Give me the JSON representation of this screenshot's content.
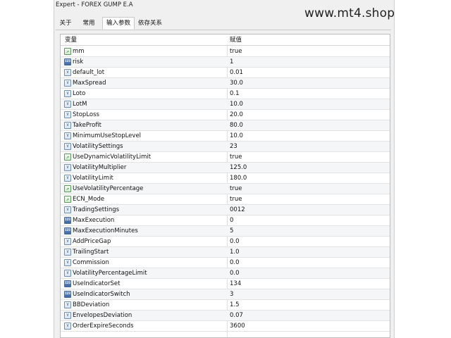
{
  "window": {
    "title": "Expert - FOREX GUMP E.A"
  },
  "watermark": "www.mt4.shop",
  "tabs": [
    {
      "label": "关于"
    },
    {
      "label": "常用"
    },
    {
      "label": "输入参数",
      "active": true
    },
    {
      "label": "依存关系"
    }
  ],
  "table": {
    "columns": {
      "variable": "变量",
      "value": "赋值"
    },
    "rows": [
      {
        "name": "mm",
        "value": "true",
        "icon": "bool-icon"
      },
      {
        "name": "risk",
        "value": "1",
        "icon": "int-icon"
      },
      {
        "name": "default_lot",
        "value": "0.01",
        "icon": "double-icon"
      },
      {
        "name": "MaxSpread",
        "value": "30.0",
        "icon": "double-icon"
      },
      {
        "name": "Loto",
        "value": "0.1",
        "icon": "double-icon"
      },
      {
        "name": "LotM",
        "value": "10.0",
        "icon": "double-icon"
      },
      {
        "name": "StopLoss",
        "value": "20.0",
        "icon": "double-icon"
      },
      {
        "name": "TakeProfit",
        "value": "80.0",
        "icon": "double-icon"
      },
      {
        "name": "MinimumUseStopLevel",
        "value": "10.0",
        "icon": "double-icon"
      },
      {
        "name": "VolatilitySettings",
        "value": "23",
        "icon": "double-icon"
      },
      {
        "name": "UseDynamicVolatilityLimit",
        "value": "true",
        "icon": "bool-icon"
      },
      {
        "name": "VolatilityMultiplier",
        "value": "125.0",
        "icon": "double-icon"
      },
      {
        "name": "VolatilityLimit",
        "value": "180.0",
        "icon": "double-icon"
      },
      {
        "name": "UseVolatilityPercentage",
        "value": "true",
        "icon": "bool-icon"
      },
      {
        "name": "ECN_Mode",
        "value": "true",
        "icon": "bool-icon"
      },
      {
        "name": "TradingSettings",
        "value": "0012",
        "icon": "double-icon"
      },
      {
        "name": "MaxExecution",
        "value": "0",
        "icon": "int-icon"
      },
      {
        "name": "MaxExecutionMinutes",
        "value": "5",
        "icon": "int-icon"
      },
      {
        "name": "AddPriceGap",
        "value": "0.0",
        "icon": "double-icon"
      },
      {
        "name": "TrailingStart",
        "value": "1.0",
        "icon": "double-icon"
      },
      {
        "name": "Commission",
        "value": "0.0",
        "icon": "double-icon"
      },
      {
        "name": "VolatilityPercentageLimit",
        "value": "0.0",
        "icon": "double-icon"
      },
      {
        "name": "UseIndicatorSet",
        "value": "134",
        "icon": "int-icon"
      },
      {
        "name": "UseIndicatorSwitch",
        "value": "3",
        "icon": "int-icon"
      },
      {
        "name": "BBDeviation",
        "value": "1.5",
        "icon": "double-icon"
      },
      {
        "name": "EnvelopesDeviation",
        "value": "0.07",
        "icon": "double-icon"
      },
      {
        "name": "OrderExpireSeconds",
        "value": "3600",
        "icon": "double-icon"
      }
    ]
  }
}
